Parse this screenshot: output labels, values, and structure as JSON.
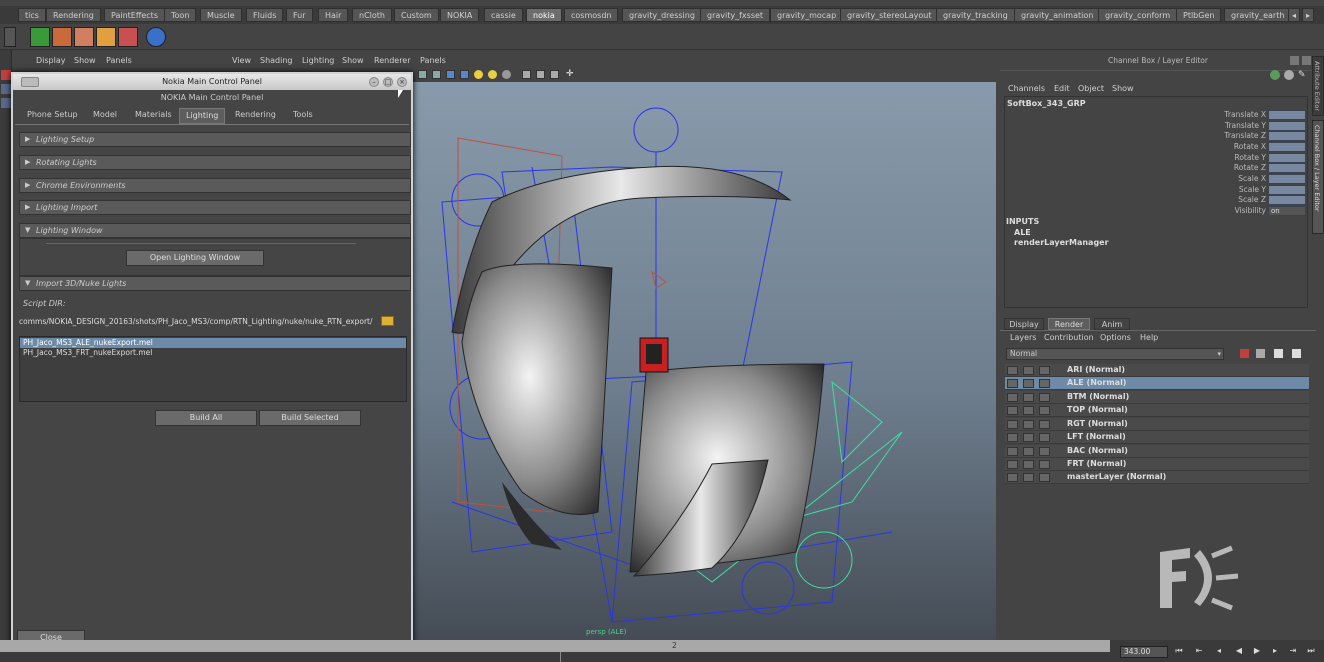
{
  "shelf": {
    "tabs": [
      "tics",
      "Rendering",
      "PaintEffects",
      "Toon",
      "Muscle",
      "Fluids",
      "Fur",
      "Hair",
      "nCloth",
      "Custom",
      "NOKIA",
      "cassie",
      "nokia",
      "cosmosdn",
      "gravity_dressing",
      "gravity_fxsset",
      "gravity_mocap",
      "gravity_stereoLayout",
      "gravity_tracking",
      "gravity_animation",
      "gravity_conform",
      "PtlbGen",
      "gravity_earth"
    ],
    "active_tab": "nokia"
  },
  "left_menu": {
    "items": [
      "Display",
      "Show",
      "Panels"
    ]
  },
  "viewport": {
    "menu": [
      "View",
      "Shading",
      "Lighting",
      "Show",
      "Renderer",
      "Panels"
    ],
    "camera_label": "persp (ALE)",
    "colors": {
      "bg_top": "#889aab",
      "bg_bottom": "#454c55",
      "wire": "#2a35e8",
      "wire_alt": "#3fe0a0"
    }
  },
  "panel": {
    "window_title": "Nokia Main Control Panel",
    "header": "NOKIA Main Control Panel",
    "tabs": [
      "Phone Setup",
      "Model",
      "Materials",
      "Lighting",
      "Rendering",
      "Tools"
    ],
    "active_tab": "Lighting",
    "sections": [
      {
        "label": "Lighting Setup",
        "expanded": false
      },
      {
        "label": "Rotating Lights",
        "expanded": false
      },
      {
        "label": "Chrome Environments",
        "expanded": false
      },
      {
        "label": "Lighting Import",
        "expanded": false
      },
      {
        "label": "Lighting Window",
        "expanded": true
      },
      {
        "label": "Import 3D/Nuke Lights",
        "expanded": true
      }
    ],
    "open_lighting_window": "Open Lighting Window",
    "script_dir_label": "Script DIR:",
    "script_dir_value": "comms/NOKIA_DESIGN_20163/shots/PH_Jaco_MS3/comp/RTN_Lighting/nuke/nuke_RTN_export/",
    "files": [
      "PH_Jaco_MS3_ALE_nukeExport.mel",
      "PH_Jaco_MS3_FRT_nukeExport.mel"
    ],
    "selected_file": 0,
    "build_all": "Build All",
    "build_selected": "Build Selected",
    "close": "Close"
  },
  "channel_box": {
    "title": "Channel Box / Layer Editor",
    "menu": [
      "Channels",
      "Edit",
      "Object",
      "Show"
    ],
    "object": "SoftBox_343_GRP",
    "attrs": [
      {
        "name": "Translate X",
        "value": ""
      },
      {
        "name": "Translate Y",
        "value": ""
      },
      {
        "name": "Translate Z",
        "value": ""
      },
      {
        "name": "Rotate X",
        "value": ""
      },
      {
        "name": "Rotate Y",
        "value": ""
      },
      {
        "name": "Rotate Z",
        "value": ""
      },
      {
        "name": "Scale X",
        "value": ""
      },
      {
        "name": "Scale Y",
        "value": ""
      },
      {
        "name": "Scale Z",
        "value": ""
      },
      {
        "name": "Visibility",
        "value": "on"
      }
    ],
    "inputs_label": "INPUTS",
    "inputs": [
      "ALE",
      "renderLayerManager"
    ]
  },
  "side_tabs": [
    "Attribute Editor",
    "Channel Box / Layer Editor"
  ],
  "layer_editor": {
    "tabs": [
      "Display",
      "Render",
      "Anim"
    ],
    "active_tab": "Render",
    "menu": [
      "Layers",
      "Contribution",
      "Options",
      "Help"
    ],
    "mode": "Normal",
    "layers": [
      "ARI (Normal)",
      "ALE (Normal)",
      "BTM (Normal)",
      "TOP (Normal)",
      "RGT (Normal)",
      "LFT (Normal)",
      "BAC (Normal)",
      "FRT (Normal)",
      "masterLayer (Normal)"
    ],
    "selected_layer": 1
  },
  "timeline": {
    "current_frame": "343.00",
    "tick_label": "2"
  }
}
